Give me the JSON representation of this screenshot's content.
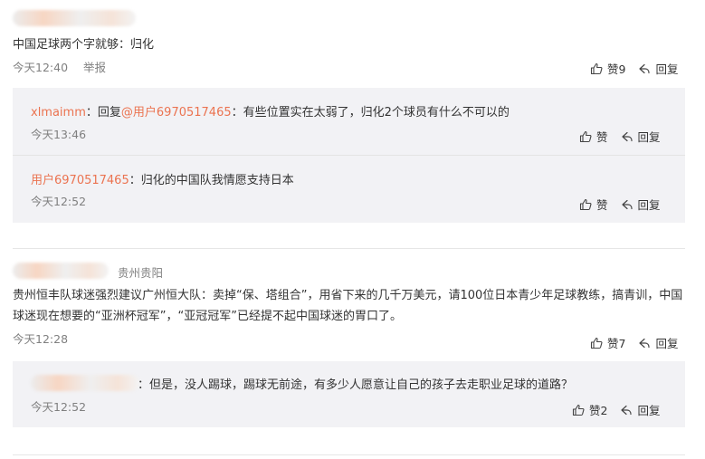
{
  "thread1": {
    "main": {
      "text": "中国足球两个字就够：归化",
      "time": "今天12:40",
      "report": "举报",
      "like_label": "赞9",
      "reply_label": "回复"
    },
    "replies": [
      {
        "author": "xlmaimm",
        "colon": "：",
        "reply_word": "回复",
        "mention": "@用户6970517465",
        "text": "：有些位置实在太弱了，归化2个球员有什么不可以的",
        "time": "今天13:46",
        "like_label": "赞",
        "reply_label": "回复"
      },
      {
        "author": "用户6970517465",
        "text": "：归化的中国队我情愿支持日本",
        "time": "今天12:52",
        "like_label": "赞",
        "reply_label": "回复"
      }
    ]
  },
  "thread2": {
    "main": {
      "location": "贵州贵阳",
      "text": "贵州恒丰队球迷强烈建议广州恒大队：卖掉“保、塔组合”，用省下来的几千万美元，请100位日本青少年足球教练，搞青训，中国球迷现在想要的“亚洲杯冠军”，“亚冠冠军”已经提不起中国球迷的胃口了。",
      "time": "今天12:28",
      "like_label": "赞7",
      "reply_label": "回复"
    },
    "replies": [
      {
        "text": "：但是，没人踢球，踢球无前途，有多少人愿意让自己的孩子去走职业足球的道路？",
        "time": "今天12:52",
        "like_label": "赞2",
        "reply_label": "回复"
      }
    ]
  },
  "icons": {
    "like": "thumbs-up-icon",
    "reply": "reply-arrow-icon"
  },
  "colors": {
    "accent": "#eb7350",
    "reply_bg": "#f2f2f5",
    "meta": "#808080"
  }
}
